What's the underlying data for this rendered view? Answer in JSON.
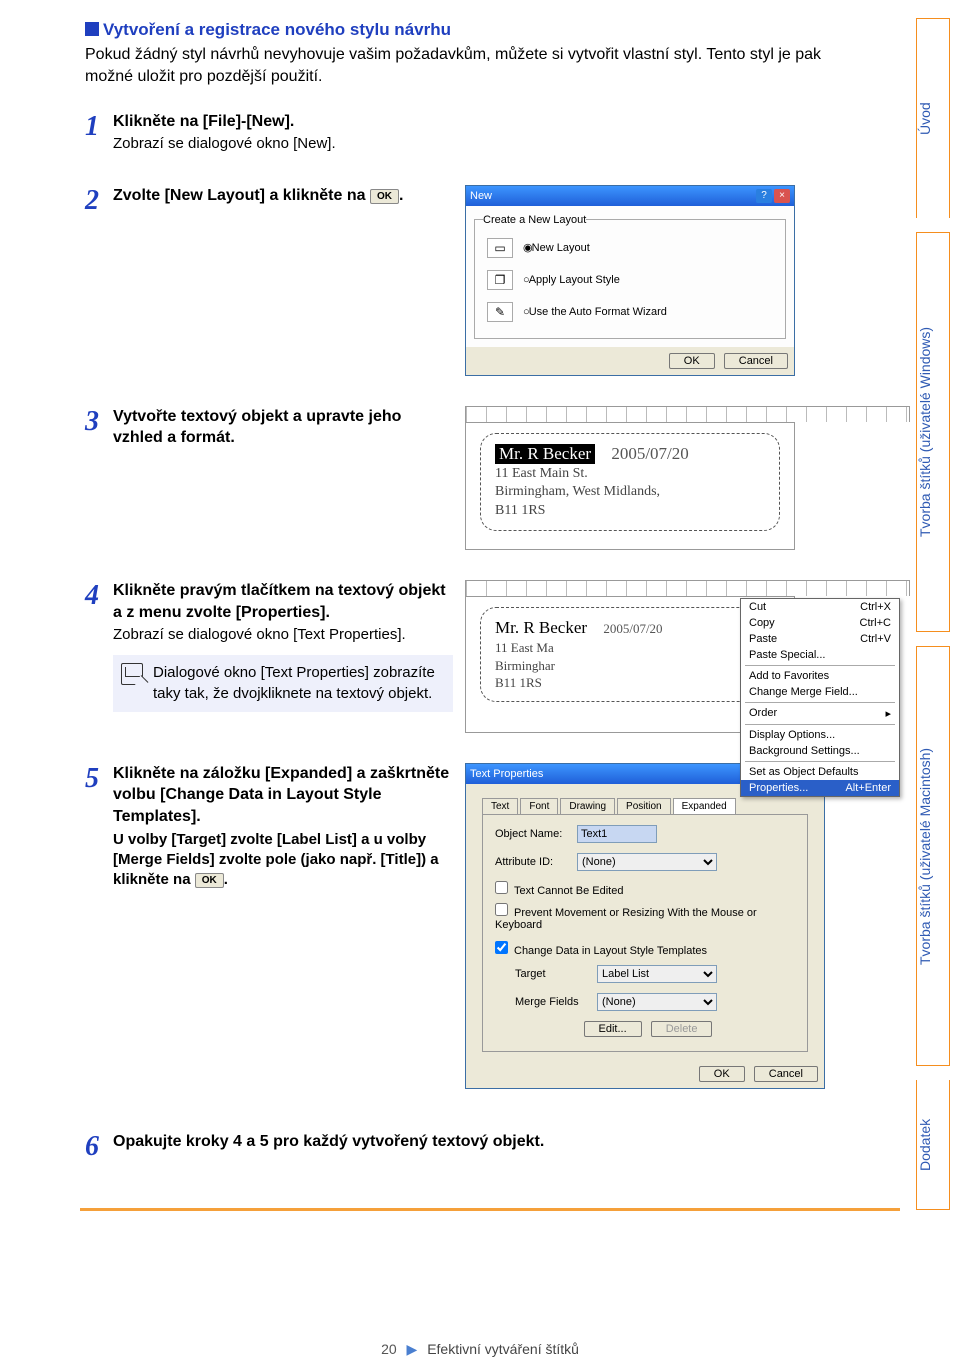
{
  "heading": "Vytvoření a registrace nového stylu návrhu",
  "intro": "Pokud žádný styl návrhů nevyhovuje vašim požadavkům, můžete si vytvořit vlastní styl. Tento styl je pak možné uložit pro pozdější použití.",
  "steps": {
    "s1": {
      "num": "1",
      "text": "Klikněte na [File]-[New].",
      "sub": "Zobrazí se dialogové okno [New]."
    },
    "s2": {
      "num": "2",
      "text_a": "Zvolte [New Layout] a klikněte na ",
      "btn": "OK",
      "text_b": "."
    },
    "s3": {
      "num": "3",
      "text": "Vytvořte textový objekt a upravte jeho vzhled a formát."
    },
    "s4": {
      "num": "4",
      "text": "Klikněte pravým tlačítkem na textový objekt a z menu zvolte [Properties].",
      "sub": "Zobrazí se dialogové okno [Text Properties].",
      "note": "Dialogové okno [Text Properties] zobrazíte taky tak, že dvojkliknete na textový objekt."
    },
    "s5": {
      "num": "5",
      "text": "Klikněte na záložku [Expanded] a zaškrtněte volbu [Change Data in Layout Style Templates].",
      "sub_a": "U volby [Target] zvolte [Label List] a u volby [Merge Fields] zvolte pole (jako např. [Title]) a klikněte na ",
      "btn": "OK",
      "sub_b": "."
    },
    "s6": {
      "num": "6",
      "text": "Opakujte kroky 4 a 5 pro každý vytvořený textový objekt."
    }
  },
  "tabs": {
    "t1": "Úvod",
    "t2": "Tvorba štítků (uživatelé Windows)",
    "t3": "Tvorba štítků (uživatelé Macintosh)",
    "t4": "Dodatek"
  },
  "dlg_new": {
    "title": "New",
    "group": "Create a New Layout",
    "opt1": "New Layout",
    "opt2": "Apply Layout Style",
    "opt3": "Use the Auto Format Wizard",
    "ok": "OK",
    "cancel": "Cancel"
  },
  "label_preview": {
    "name": "Mr. R Becker",
    "date": "2005/07/20",
    "addr1": "11 East Main St.",
    "addr2": "Birmingham, West Midlands,",
    "addr3": "B11 1RS"
  },
  "ctx": {
    "cut": "Cut",
    "cut_k": "Ctrl+X",
    "copy": "Copy",
    "copy_k": "Ctrl+C",
    "paste": "Paste",
    "paste_k": "Ctrl+V",
    "pastesp": "Paste Special...",
    "addfav": "Add to Favorites",
    "chmerge": "Change Merge Field...",
    "order": "Order",
    "disp": "Display Options...",
    "bg": "Background Settings...",
    "defaults": "Set as Object Defaults",
    "props": "Properties...",
    "props_k": "Alt+Enter"
  },
  "dlg_props": {
    "title": "Text Properties",
    "tabs": [
      "Text",
      "Font",
      "Drawing",
      "Position",
      "Expanded"
    ],
    "objname_lbl": "Object Name:",
    "objname_val": "Text1",
    "attrid_lbl": "Attribute ID:",
    "attrid_val": "(None)",
    "chk1": "Text Cannot Be Edited",
    "chk2": "Prevent Movement or Resizing With the Mouse or Keyboard",
    "chk3": "Change Data in Layout Style Templates",
    "target_lbl": "Target",
    "target_val": "Label List",
    "merge_lbl": "Merge Fields",
    "merge_val": "(None)",
    "edit": "Edit...",
    "delete": "Delete",
    "ok": "OK",
    "cancel": "Cancel"
  },
  "footer": {
    "page": "20",
    "section": "Efektivní vytváření štítků"
  }
}
